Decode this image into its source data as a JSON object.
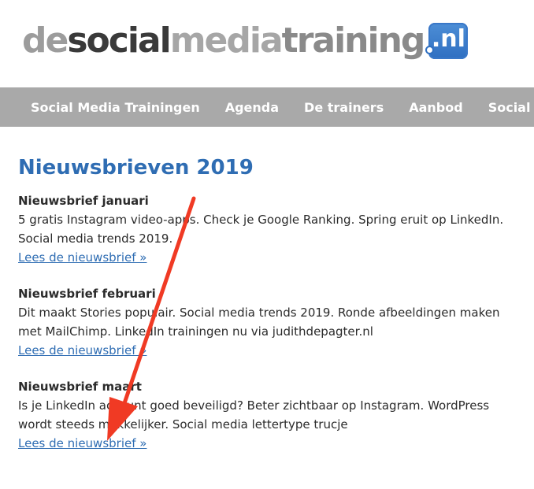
{
  "logo": {
    "seg_de": "de",
    "seg_social": "social",
    "seg_media": "media",
    "seg_training": "training",
    "badge": ".nl"
  },
  "nav": {
    "items": [
      {
        "label": "Social Media Trainingen"
      },
      {
        "label": "Agenda"
      },
      {
        "label": "De trainers"
      },
      {
        "label": "Aanbod"
      },
      {
        "label": "Social Media t"
      }
    ]
  },
  "main": {
    "title": "Nieuwsbrieven 2019",
    "newsletters": [
      {
        "title": "Nieuwsbrief januari",
        "description": "5 gratis Instagram video-apps. Check je Google Ranking. Spring eruit op LinkedIn. Social media trends 2019.",
        "link": "Lees de nieuwsbrief »"
      },
      {
        "title": "Nieuwsbrief februari",
        "description": "Dit maakt Stories populair. Social media trends 2019. Ronde afbeeldingen maken met MailChimp. LinkedIn trainingen nu via judithdepagter.nl",
        "link": "Lees de nieuwsbrief »"
      },
      {
        "title": "Nieuwsbrief maart",
        "description": "Is je LinkedIn account goed beveiligd? Beter zichtbaar op Instagram. WordPress wordt steeds makkelijker. Social media lettertype trucje",
        "link": "Lees de nieuwsbrief »"
      }
    ]
  },
  "colors": {
    "nav_background": "#a9a9a9",
    "title_blue": "#2f6db3",
    "arrow_red": "#f03a24"
  }
}
